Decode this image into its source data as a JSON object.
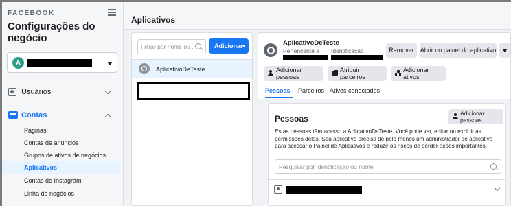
{
  "sidebar": {
    "brand": "FACEBOOK",
    "title": "Configurações do negócio",
    "account_initial": "A",
    "nav": {
      "users_label": "Usuários",
      "contas_label": "Contas"
    },
    "sub_items": [
      {
        "label": "Páginas",
        "active": false
      },
      {
        "label": "Contas de anúncios",
        "active": false
      },
      {
        "label": "Grupos de ativos de negócios",
        "active": false
      },
      {
        "label": "Aplicativos",
        "active": true
      },
      {
        "label": "Contas do Instagram",
        "active": false
      },
      {
        "label": "Linha de negócios",
        "active": false
      }
    ]
  },
  "header": {
    "title": "Aplicativos"
  },
  "list_panel": {
    "filter_placeholder": "Filtrar por nome ou ...",
    "add_button_label": "Adicionar",
    "apps": [
      {
        "name": "AplicativoDeTeste",
        "selected": true
      }
    ]
  },
  "detail": {
    "app_name": "AplicativoDeTeste",
    "owner_label": "Pertencente a",
    "id_label": "Identificação",
    "remove_label": "Remover",
    "open_panel_label": "Abrir no painel do aplicativo",
    "actions": {
      "add_people": "Adicionar pessoas",
      "assign_partners": "Atribuir parceiros",
      "add_assets": "Adicionar ativos"
    },
    "tabs": [
      {
        "label": "Pessoas",
        "active": true
      },
      {
        "label": "Parceiros",
        "active": false
      },
      {
        "label": "Ativos conectados",
        "active": false
      }
    ],
    "people": {
      "title": "Pessoas",
      "add_button_label": "Adicionar pessoas",
      "description": "Estas pessoas têm acesso a AplicativoDeTeste. Você pode ver, editar ou excluir as permissões delas. Seu aplicativo precisa de pelo menos um administrador de aplicativo para acessar o Painel de Aplicativos e reduzir os riscos de perder ações importantes.",
      "search_placeholder": "Pesquisar por identificação ou nome"
    }
  },
  "colors": {
    "accent": "#1877f2",
    "selected_bg": "#e7f3ff",
    "redaction": "#000000"
  }
}
